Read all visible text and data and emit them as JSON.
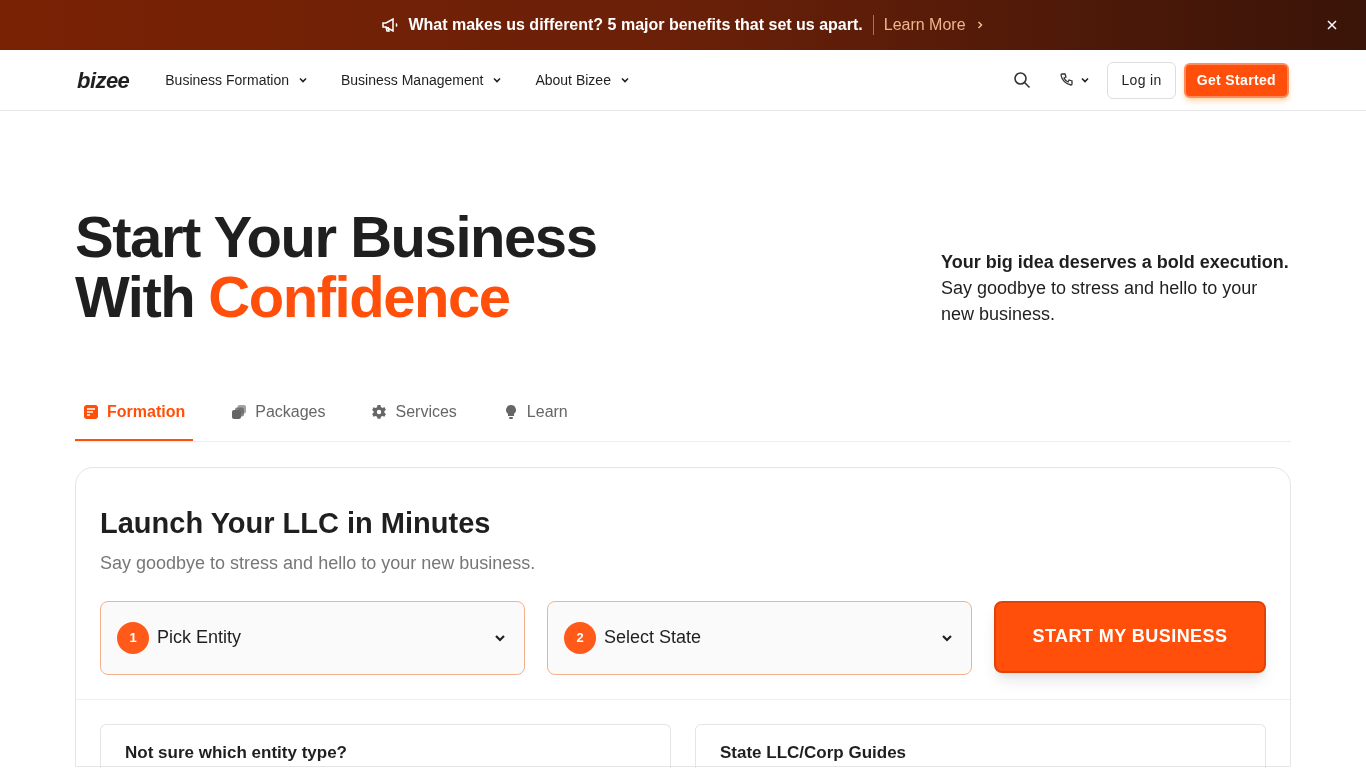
{
  "banner": {
    "message": "What makes us different? 5 major benefits that set us apart.",
    "link": "Learn More"
  },
  "nav": {
    "logo": "bizee",
    "menu": [
      {
        "label": "Business Formation"
      },
      {
        "label": "Business Management"
      },
      {
        "label": "About Bizee"
      }
    ],
    "login": "Log in",
    "cta": "Get Started"
  },
  "hero": {
    "title_line1": "Start Your Business",
    "title_line2_plain": "With",
    "title_line2_accent": "Confidence",
    "tagline": "Your big idea deserves a bold execution.",
    "description": "Say goodbye to stress and hello to your new business."
  },
  "tabs": [
    {
      "label": "Formation",
      "selected": true
    },
    {
      "label": "Packages",
      "selected": false
    },
    {
      "label": "Services",
      "selected": false
    },
    {
      "label": "Learn",
      "selected": false
    }
  ],
  "panel": {
    "title": "Launch Your LLC in Minutes",
    "subtitle": "Say goodbye to stress and hello to your new business.",
    "steps": [
      {
        "number": "1",
        "label": "Pick Entity"
      },
      {
        "number": "2",
        "label": "Select State"
      }
    ],
    "button": "START MY BUSINESS",
    "cards": [
      {
        "title": "Not sure which entity type?"
      },
      {
        "title": "State LLC/Corp Guides"
      }
    ]
  }
}
